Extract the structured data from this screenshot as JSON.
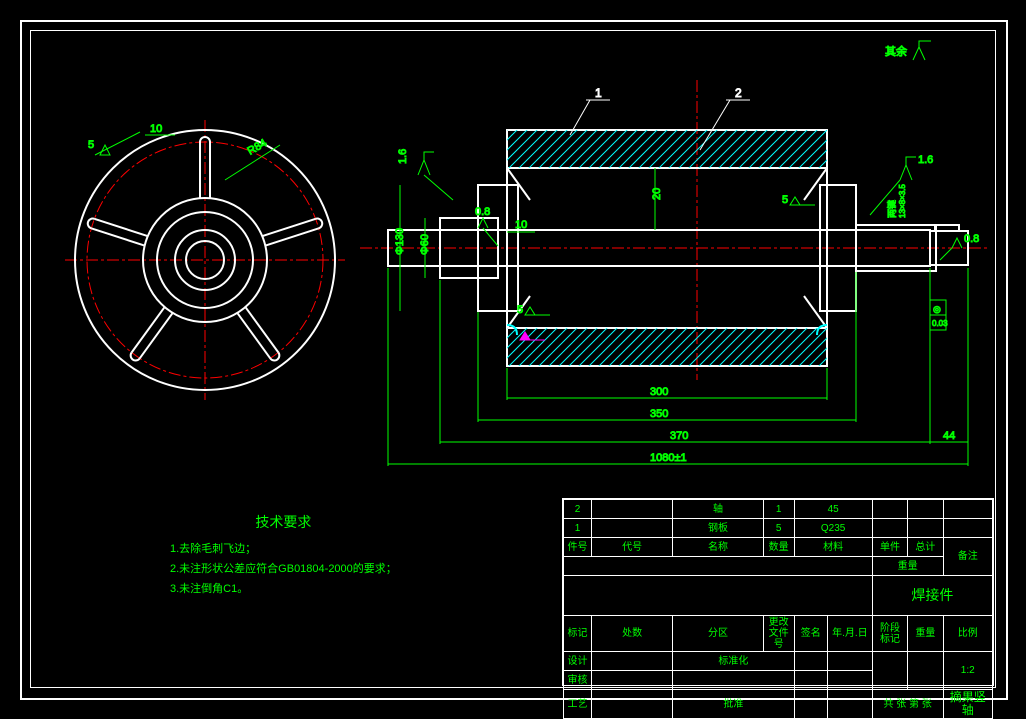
{
  "meta": {
    "surface_note_text": "其余",
    "tech_req_title": "技术要求",
    "tech_req_items": [
      "1.去除毛刺飞边；",
      "2.未注形状公差应符合GB01804-2000的要求；",
      "3.未注倒角C1。"
    ]
  },
  "dimensions": {
    "left_offset": "5",
    "left_slot": "10",
    "left_radius_label": "R84",
    "surf_left": "1.6",
    "surf_right": "1.6",
    "surf_inner1": "0.8",
    "surf_inner2": "0.8",
    "weld1": "5",
    "weld2": "5",
    "inner_dim": "10",
    "inner_dim2": "20",
    "dia1": "Φ130",
    "dia2": "Φ60",
    "len_300": "300",
    "len_350": "350",
    "len_370": "370",
    "len_total": "1080±1",
    "tail": "44",
    "key": "两键",
    "key_dim": "13×8×3.5",
    "balloon1": "1",
    "balloon2": "2",
    "gtol": "0.03",
    "gtol_sym": "◎"
  },
  "title_block": {
    "parts": [
      {
        "no": "2",
        "code": "",
        "name": "轴",
        "qty": "1",
        "mat": "45"
      },
      {
        "no": "1",
        "code": "",
        "name": "钢板",
        "qty": "5",
        "mat": "Q235"
      }
    ],
    "headers": {
      "no": "件号",
      "code": "代号",
      "name": "名称",
      "qty": "数量",
      "mat": "材料",
      "unit_wt": "单件",
      "total_wt": "总计",
      "wt": "重量",
      "note": "备注"
    },
    "main": {
      "assembly": "焊接件",
      "drawing_name": "摘果竖轴",
      "row_labels": {
        "mark": "标记",
        "count": "处数",
        "zone": "分区",
        "change": "更改文件号",
        "sign": "签名",
        "date": "年.月.日",
        "design": "设计",
        "standardize": "标准化",
        "check": "审核",
        "process": "工艺",
        "approve": "批准",
        "stage": "阶段标记",
        "weight": "重量",
        "scale": "比例",
        "sheets": "共   张   第   张"
      },
      "scale": "1:2"
    }
  }
}
